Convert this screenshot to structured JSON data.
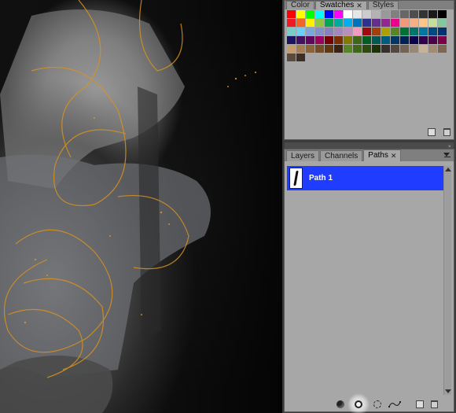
{
  "swatches_panel": {
    "tabs": [
      {
        "label": "Color",
        "active": false
      },
      {
        "label": "Swatches",
        "active": true
      },
      {
        "label": "Styles",
        "active": false
      }
    ],
    "close_glyph": "✕",
    "colors": [
      "#ff0000",
      "#ffff00",
      "#00ff00",
      "#00ffff",
      "#0000ff",
      "#ff00ff",
      "#ffffff",
      "#e6e6e6",
      "#cccccc",
      "#b3b3b3",
      "#999999",
      "#808080",
      "#666666",
      "#4d4d4d",
      "#333333",
      "#1a1a1a",
      "#000000",
      "#ed1c24",
      "#f26522",
      "#fff200",
      "#8dc63f",
      "#00a651",
      "#00a99d",
      "#00aeef",
      "#0072bc",
      "#2e3192",
      "#662d91",
      "#92278f",
      "#ec008c",
      "#f7977a",
      "#fbad82",
      "#fdc689",
      "#c4df9b",
      "#82ca9c",
      "#7accc8",
      "#6dcff6",
      "#7da7d9",
      "#8393ca",
      "#8781bd",
      "#a187be",
      "#bd8cbf",
      "#f49ac1",
      "#9e0b0f",
      "#a0410d",
      "#aba000",
      "#598527",
      "#007236",
      "#00746b",
      "#0076a3",
      "#004a80",
      "#003471",
      "#1b1464",
      "#440e62",
      "#630460",
      "#9e005d",
      "#790000",
      "#7b2e00",
      "#827b00",
      "#406618",
      "#005e20",
      "#005952",
      "#005b7f",
      "#003663",
      "#002157",
      "#0d004c",
      "#32004b",
      "#4b0049",
      "#7b0046",
      "#c69c6d",
      "#a67c52",
      "#8c6239",
      "#754c24",
      "#603913",
      "#3c2415",
      "#598527",
      "#406618",
      "#2e4b0f",
      "#1d3209",
      "#362f2d",
      "#534741",
      "#736357",
      "#998675",
      "#c7b299",
      "#a38b73",
      "#7d6754",
      "#5c4a3d",
      "#402d24"
    ],
    "footer_icons": [
      "new-swatch-icon",
      "trash-icon"
    ]
  },
  "paths_panel": {
    "tabs": [
      {
        "label": "Layers",
        "active": false
      },
      {
        "label": "Channels",
        "active": false
      },
      {
        "label": "Paths",
        "active": true
      }
    ],
    "close_glyph": "✕",
    "paths": [
      {
        "name": "Path 1",
        "selected": true
      }
    ],
    "footer_icons": [
      "fill-path-icon",
      "stroke-path-icon",
      "load-selection-icon",
      "make-work-path-icon",
      "new-path-icon",
      "trash-icon"
    ]
  },
  "canvas": {
    "description_icon": "photo-canvas"
  }
}
